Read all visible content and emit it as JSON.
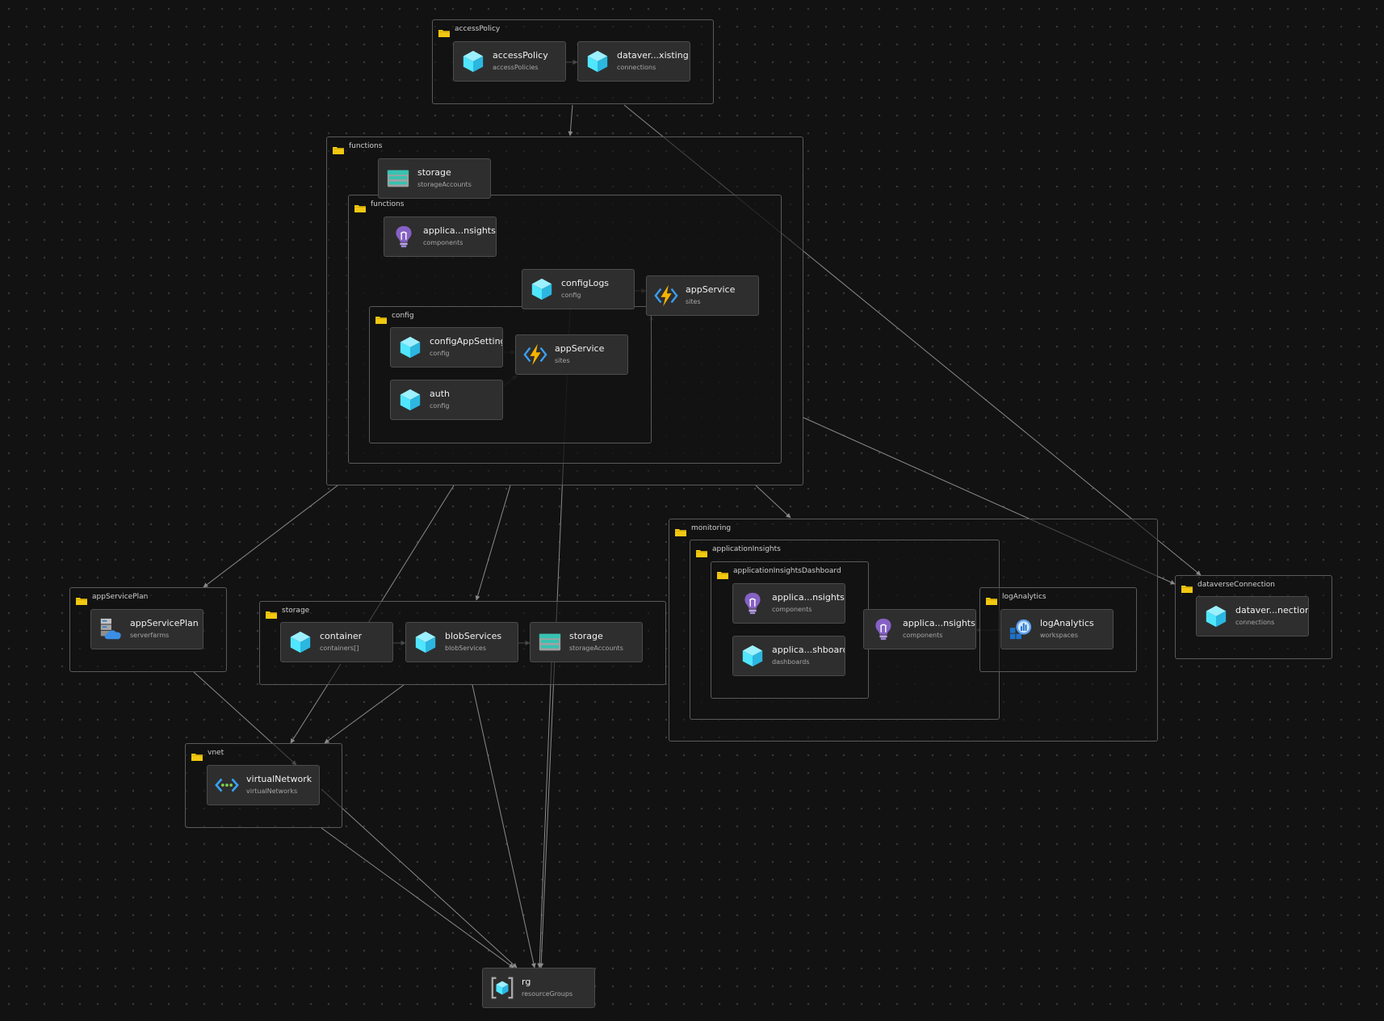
{
  "diagram": {
    "groups": [
      {
        "id": "g-accessPolicy",
        "label": "accessPolicy"
      },
      {
        "id": "g-functions",
        "label": "functions"
      },
      {
        "id": "g-functions-inner",
        "label": "functions"
      },
      {
        "id": "g-config",
        "label": "config"
      },
      {
        "id": "g-appServicePlan",
        "label": "appServicePlan"
      },
      {
        "id": "g-storage",
        "label": "storage"
      },
      {
        "id": "g-vnet",
        "label": "vnet"
      },
      {
        "id": "g-monitoring",
        "label": "monitoring"
      },
      {
        "id": "g-applicationInsights",
        "label": "applicationInsights"
      },
      {
        "id": "g-applicationInsightsDashboard",
        "label": "applicationInsightsDashboard"
      },
      {
        "id": "g-logAnalytics",
        "label": "logAnalytics"
      },
      {
        "id": "g-dataverseConnection",
        "label": "dataverseConnection"
      }
    ],
    "nodes": [
      {
        "id": "n-accessPolicy",
        "name": "accessPolicy",
        "type": "accessPolicies",
        "icon": "cube-icon"
      },
      {
        "id": "n-dataverseExisting",
        "name": "dataver...xisting",
        "type": "connections",
        "icon": "cube-icon"
      },
      {
        "id": "n-storageFn",
        "name": "storage",
        "type": "storageAccounts",
        "icon": "storage-account-icon"
      },
      {
        "id": "n-appInsightsFn",
        "name": "applica...nsights",
        "type": "components",
        "icon": "lightbulb-icon"
      },
      {
        "id": "n-configLogs",
        "name": "configLogs",
        "type": "config",
        "icon": "cube-icon"
      },
      {
        "id": "n-appServiceOuter",
        "name": "appService",
        "type": "sites",
        "icon": "function-bolt-icon"
      },
      {
        "id": "n-configAppSettings",
        "name": "configAppSettings",
        "type": "config",
        "icon": "cube-icon"
      },
      {
        "id": "n-appServiceInner",
        "name": "appService",
        "type": "sites",
        "icon": "function-bolt-icon"
      },
      {
        "id": "n-auth",
        "name": "auth",
        "type": "config",
        "icon": "cube-icon"
      },
      {
        "id": "n-appServicePlan",
        "name": "appServicePlan",
        "type": "serverfarms",
        "icon": "server-farm-icon"
      },
      {
        "id": "n-container",
        "name": "container",
        "type": "containers[]",
        "icon": "cube-icon"
      },
      {
        "id": "n-blobServices",
        "name": "blobServices",
        "type": "blobServices",
        "icon": "cube-icon"
      },
      {
        "id": "n-storage",
        "name": "storage",
        "type": "storageAccounts",
        "icon": "storage-account-icon"
      },
      {
        "id": "n-virtualNetwork",
        "name": "virtualNetwork",
        "type": "virtualNetworks",
        "icon": "virtual-network-icon"
      },
      {
        "id": "n-appInsightsDash",
        "name": "applica...nsights",
        "type": "components",
        "icon": "lightbulb-icon"
      },
      {
        "id": "n-appDashboard",
        "name": "applica...shboard",
        "type": "dashboards",
        "icon": "cube-icon"
      },
      {
        "id": "n-appInsightsMon",
        "name": "applica...nsights",
        "type": "components",
        "icon": "lightbulb-icon"
      },
      {
        "id": "n-logAnalytics",
        "name": "logAnalytics",
        "type": "workspaces",
        "icon": "log-analytics-icon"
      },
      {
        "id": "n-dataverseConnection",
        "name": "dataver...nection",
        "type": "connections",
        "icon": "cube-icon"
      },
      {
        "id": "n-rg",
        "name": "rg",
        "type": "resourceGroups",
        "icon": "resource-group-icon"
      }
    ],
    "edges": [
      {
        "from": "n-accessPolicy",
        "to": "n-dataverseExisting"
      },
      {
        "from": "g-accessPolicy",
        "to": "g-functions"
      },
      {
        "from": "g-accessPolicy",
        "to": "g-dataverseConnection"
      },
      {
        "from": "n-configLogs",
        "to": "n-appServiceOuter"
      },
      {
        "from": "n-configAppSettings",
        "to": "n-appServiceInner"
      },
      {
        "from": "n-auth",
        "to": "n-appServiceInner"
      },
      {
        "from": "g-config",
        "to": "n-appServiceOuter"
      },
      {
        "from": "g-functions",
        "to": "g-appServicePlan"
      },
      {
        "from": "g-functions",
        "to": "g-storage"
      },
      {
        "from": "g-functions",
        "to": "g-monitoring"
      },
      {
        "from": "g-functions",
        "to": "g-dataverseConnection"
      },
      {
        "from": "g-functions",
        "to": "g-vnet"
      },
      {
        "from": "n-container",
        "to": "n-blobServices"
      },
      {
        "from": "n-blobServices",
        "to": "n-storage"
      },
      {
        "from": "g-storage",
        "to": "g-vnet"
      },
      {
        "from": "n-logAnalytics",
        "to": "n-appInsightsMon"
      },
      {
        "from": "n-configLogs",
        "to": "n-rg"
      },
      {
        "from": "g-appServicePlan",
        "to": "n-rg"
      },
      {
        "from": "g-vnet",
        "to": "n-rg"
      },
      {
        "from": "g-storage",
        "to": "n-rg"
      },
      {
        "from": "n-storage",
        "to": "n-rg"
      },
      {
        "from": "g-monitoring",
        "to": "n-rg"
      },
      {
        "from": "g-dataverseConnection",
        "to": "n-rg"
      }
    ]
  },
  "colors": {
    "background": "#121212",
    "node_fill": "#2e2e2e",
    "edge": "#8a8a8a",
    "folder": "#f2c811",
    "cube": "#50e6ff",
    "lightbulb": "#8661c5",
    "bolt": "#f4b400"
  }
}
